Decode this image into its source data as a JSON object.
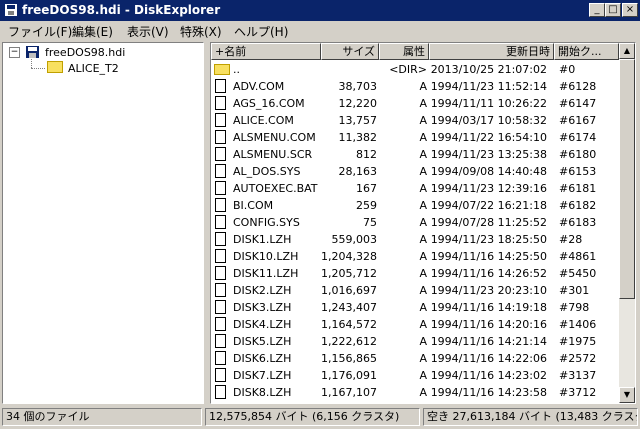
{
  "window": {
    "title": "freeDOS98.hdi - DiskExplorer"
  },
  "title_buttons": {
    "minimize": "_",
    "maximize": "□",
    "close": "×"
  },
  "menu": [
    "ファイル(F)",
    "編集(E)",
    "表示(V)",
    "特殊(X)",
    "ヘルプ(H)"
  ],
  "tree": {
    "expander": "−",
    "root": "freeDOS98.hdi",
    "child": "ALICE_T2"
  },
  "list": {
    "columns": [
      "+名前",
      "サイズ",
      "属性",
      "更新日時",
      "開始ク..."
    ],
    "rows": [
      {
        "name": "..",
        "size": "",
        "attr": "<DIR>",
        "date": "2013/10/25 21:07:02",
        "cluster": "#0",
        "folder": true
      },
      {
        "name": "ADV.COM",
        "size": "38,703",
        "attr": "A",
        "date": "1994/11/23 11:52:14",
        "cluster": "#6128"
      },
      {
        "name": "AGS_16.COM",
        "size": "12,220",
        "attr": "A",
        "date": "1994/11/11 10:26:22",
        "cluster": "#6147"
      },
      {
        "name": "ALICE.COM",
        "size": "13,757",
        "attr": "A",
        "date": "1994/03/17 10:58:32",
        "cluster": "#6167"
      },
      {
        "name": "ALSMENU.COM",
        "size": "11,382",
        "attr": "A",
        "date": "1994/11/22 16:54:10",
        "cluster": "#6174"
      },
      {
        "name": "ALSMENU.SCR",
        "size": "812",
        "attr": "A",
        "date": "1994/11/23 13:25:38",
        "cluster": "#6180"
      },
      {
        "name": "AL_DOS.SYS",
        "size": "28,163",
        "attr": "A",
        "date": "1994/09/08 14:40:48",
        "cluster": "#6153"
      },
      {
        "name": "AUTOEXEC.BAT",
        "size": "167",
        "attr": "A",
        "date": "1994/11/23 12:39:16",
        "cluster": "#6181"
      },
      {
        "name": "BI.COM",
        "size": "259",
        "attr": "A",
        "date": "1994/07/22 16:21:18",
        "cluster": "#6182"
      },
      {
        "name": "CONFIG.SYS",
        "size": "75",
        "attr": "A",
        "date": "1994/07/28 11:25:52",
        "cluster": "#6183"
      },
      {
        "name": "DISK1.LZH",
        "size": "559,003",
        "attr": "A",
        "date": "1994/11/23 18:25:50",
        "cluster": "#28"
      },
      {
        "name": "DISK10.LZH",
        "size": "1,204,328",
        "attr": "A",
        "date": "1994/11/16 14:25:50",
        "cluster": "#4861"
      },
      {
        "name": "DISK11.LZH",
        "size": "1,205,712",
        "attr": "A",
        "date": "1994/11/16 14:26:52",
        "cluster": "#5450"
      },
      {
        "name": "DISK2.LZH",
        "size": "1,016,697",
        "attr": "A",
        "date": "1994/11/23 20:23:10",
        "cluster": "#301"
      },
      {
        "name": "DISK3.LZH",
        "size": "1,243,407",
        "attr": "A",
        "date": "1994/11/16 14:19:18",
        "cluster": "#798"
      },
      {
        "name": "DISK4.LZH",
        "size": "1,164,572",
        "attr": "A",
        "date": "1994/11/16 14:20:16",
        "cluster": "#1406"
      },
      {
        "name": "DISK5.LZH",
        "size": "1,222,612",
        "attr": "A",
        "date": "1994/11/16 14:21:14",
        "cluster": "#1975"
      },
      {
        "name": "DISK6.LZH",
        "size": "1,156,865",
        "attr": "A",
        "date": "1994/11/16 14:22:06",
        "cluster": "#2572"
      },
      {
        "name": "DISK7.LZH",
        "size": "1,176,091",
        "attr": "A",
        "date": "1994/11/16 14:23:02",
        "cluster": "#3137"
      },
      {
        "name": "DISK8.LZH",
        "size": "1,167,107",
        "attr": "A",
        "date": "1994/11/16 14:23:58",
        "cluster": "#3712"
      }
    ]
  },
  "status": {
    "files": "34 個のファイル",
    "total": "12,575,854 バイト (6,156 クラスタ)",
    "free": "空き 27,613,184 バイト (13,483 クラスタ)"
  },
  "scroll": {
    "up": "▲",
    "down": "▼"
  }
}
